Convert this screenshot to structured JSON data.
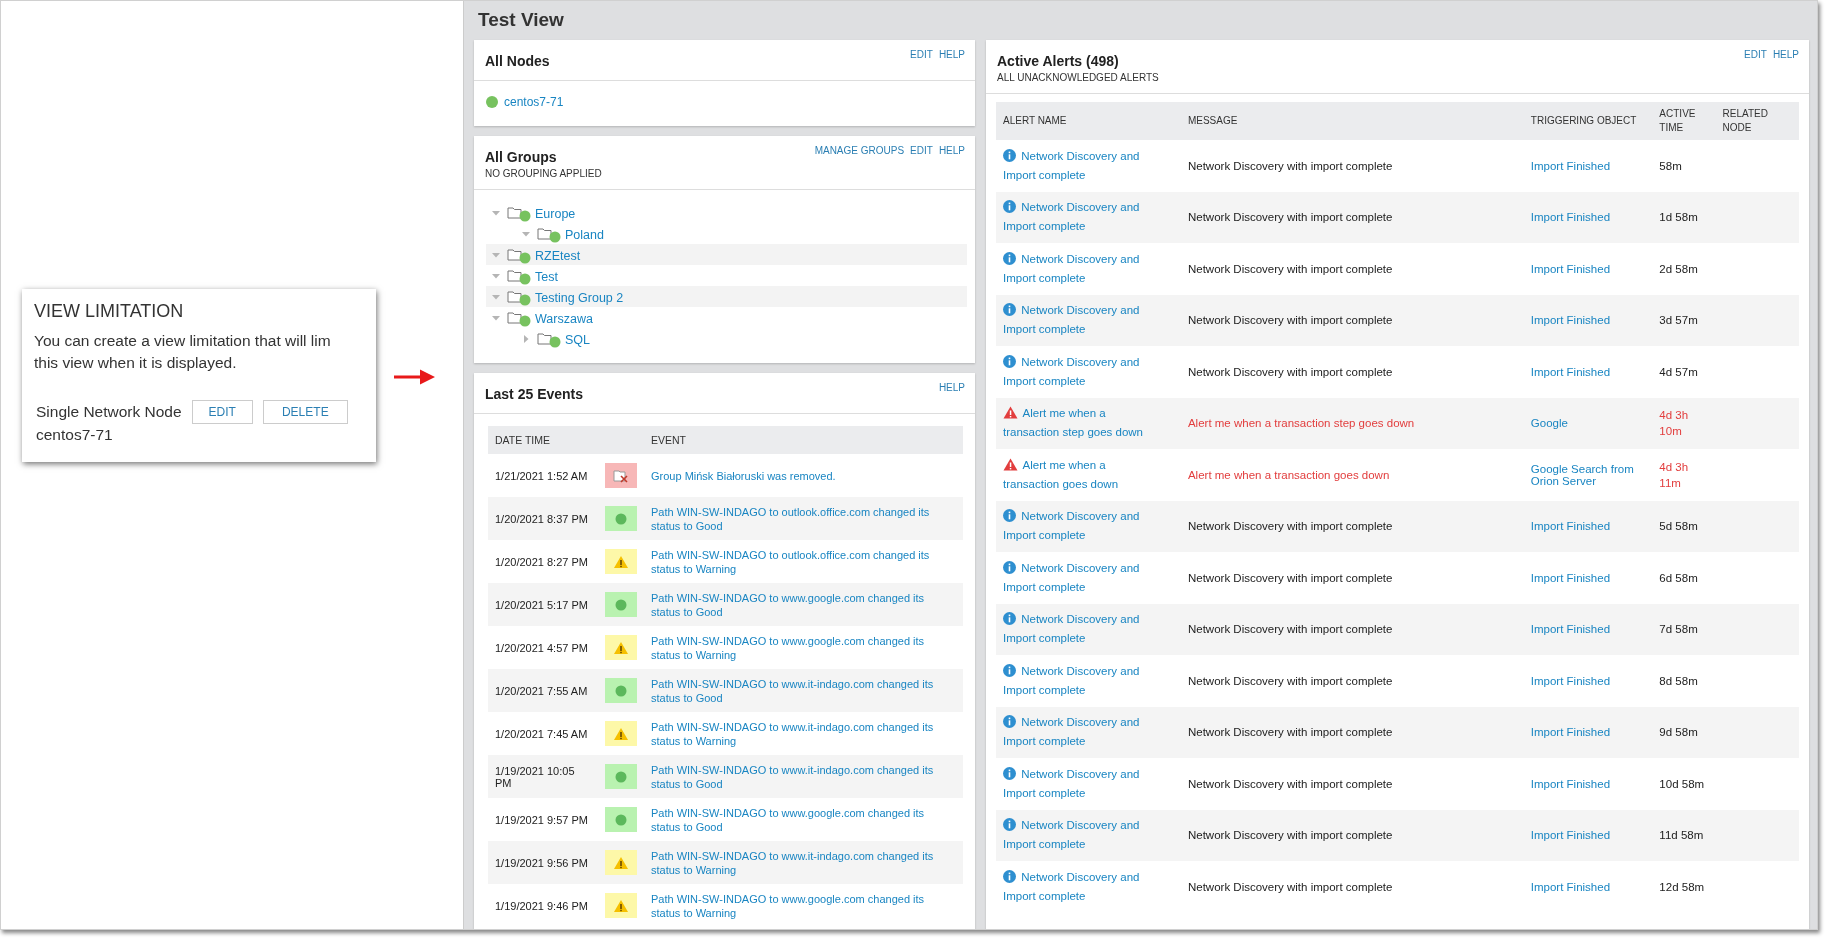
{
  "view_limitation": {
    "title": "VIEW LIMITATION",
    "text": "You can create a view limitation that will lim\nthis view when it is displayed.",
    "limit_name": "Single Network Node",
    "limit_value": "centos7-71",
    "buttons": [
      "EDIT",
      "DELETE"
    ]
  },
  "page_title": "Test View",
  "all_nodes": {
    "title": "All Nodes",
    "actions": [
      "EDIT",
      "HELP"
    ],
    "nodes": [
      {
        "name": "centos7-71",
        "color": "#77c25f"
      }
    ]
  },
  "all_groups": {
    "title": "All Groups",
    "subtitle": "NO GROUPING APPLIED",
    "actions": [
      "MANAGE GROUPS",
      "EDIT",
      "HELP"
    ],
    "groups": [
      {
        "name": "Europe",
        "color": "#77c25f",
        "expanded": true,
        "children": [
          {
            "name": "Poland",
            "color": "#77c25f",
            "expanded": true
          }
        ]
      },
      {
        "name": "RZEtest",
        "color": "#77c25f",
        "expanded": true
      },
      {
        "name": "Test",
        "color": "#77c25f",
        "expanded": true
      },
      {
        "name": "Testing Group 2",
        "color": "#77c25f",
        "expanded": true
      },
      {
        "name": "Warszawa",
        "color": "#77c25f",
        "expanded": true,
        "children": [
          {
            "name": "SQL",
            "color": "#77c25f",
            "expanded": false
          }
        ]
      }
    ]
  },
  "events": {
    "title": "Last 25 Events",
    "actions": [
      "HELP"
    ],
    "columns": [
      "DATE TIME",
      "EVENT"
    ],
    "rows": [
      {
        "time": "1/21/2021 1:52 AM",
        "kind": "removed",
        "text": "Group Mińsk Białoruski was removed."
      },
      {
        "time": "1/20/2021 8:37 PM",
        "kind": "good",
        "text": "Path WIN-SW-INDAGO to outlook.office.com changed its status to Good"
      },
      {
        "time": "1/20/2021 8:27 PM",
        "kind": "warning",
        "text": "Path WIN-SW-INDAGO to outlook.office.com changed its status to Warning"
      },
      {
        "time": "1/20/2021 5:17 PM",
        "kind": "good",
        "text": "Path WIN-SW-INDAGO to www.google.com changed its status to Good"
      },
      {
        "time": "1/20/2021 4:57 PM",
        "kind": "warning",
        "text": "Path WIN-SW-INDAGO to www.google.com changed its status to Warning"
      },
      {
        "time": "1/20/2021 7:55 AM",
        "kind": "good",
        "text": "Path WIN-SW-INDAGO to www.it-indago.com changed its status to Good"
      },
      {
        "time": "1/20/2021 7:45 AM",
        "kind": "warning",
        "text": "Path WIN-SW-INDAGO to www.it-indago.com changed its status to Warning"
      },
      {
        "time": "1/19/2021 10:05 PM",
        "kind": "good",
        "text": "Path WIN-SW-INDAGO to www.it-indago.com changed its status to Good"
      },
      {
        "time": "1/19/2021 9:57 PM",
        "kind": "good",
        "text": "Path WIN-SW-INDAGO to www.google.com changed its status to Good"
      },
      {
        "time": "1/19/2021 9:56 PM",
        "kind": "warning",
        "text": "Path WIN-SW-INDAGO to www.it-indago.com changed its status to Warning"
      },
      {
        "time": "1/19/2021 9:46 PM",
        "kind": "warning",
        "text": "Path WIN-SW-INDAGO to www.google.com changed its status to Warning"
      }
    ]
  },
  "alerts": {
    "title": "Active Alerts (498)",
    "subtitle": "ALL UNACKNOWLEDGED ALERTS",
    "actions": [
      "EDIT",
      "HELP"
    ],
    "columns": [
      "ALERT NAME",
      "MESSAGE",
      "TRIGGERING OBJECT",
      "ACTIVE TIME",
      "RELATED NODE"
    ],
    "rows": [
      {
        "kind": "info",
        "name": "Network Discovery and Import complete",
        "message": "Network Discovery with import complete",
        "object": "Import Finished",
        "active_time": "58m"
      },
      {
        "kind": "info",
        "name": "Network Discovery and Import complete",
        "message": "Network Discovery with import complete",
        "object": "Import Finished",
        "active_time": "1d 58m"
      },
      {
        "kind": "info",
        "name": "Network Discovery and Import complete",
        "message": "Network Discovery with import complete",
        "object": "Import Finished",
        "active_time": "2d 58m"
      },
      {
        "kind": "info",
        "name": "Network Discovery and Import complete",
        "message": "Network Discovery with import complete",
        "object": "Import Finished",
        "active_time": "3d 57m"
      },
      {
        "kind": "info",
        "name": "Network Discovery and Import complete",
        "message": "Network Discovery with import complete",
        "object": "Import Finished",
        "active_time": "4d 57m"
      },
      {
        "kind": "critical",
        "name": "Alert me when a transaction step goes down",
        "message": "Alert me when a transaction step goes down",
        "object": "Google",
        "active_time": "4d 3h 10m"
      },
      {
        "kind": "critical",
        "name": "Alert me when a transaction goes down",
        "message": "Alert me when a transaction goes down",
        "object": "Google Search from Orion Server",
        "active_time": "4d 3h 11m"
      },
      {
        "kind": "info",
        "name": "Network Discovery and Import complete",
        "message": "Network Discovery with import complete",
        "object": "Import Finished",
        "active_time": "5d 58m"
      },
      {
        "kind": "info",
        "name": "Network Discovery and Import complete",
        "message": "Network Discovery with import complete",
        "object": "Import Finished",
        "active_time": "6d 58m"
      },
      {
        "kind": "info",
        "name": "Network Discovery and Import complete",
        "message": "Network Discovery with import complete",
        "object": "Import Finished",
        "active_time": "7d 58m"
      },
      {
        "kind": "info",
        "name": "Network Discovery and Import complete",
        "message": "Network Discovery with import complete",
        "object": "Import Finished",
        "active_time": "8d 58m"
      },
      {
        "kind": "info",
        "name": "Network Discovery and Import complete",
        "message": "Network Discovery with import complete",
        "object": "Import Finished",
        "active_time": "9d 58m"
      },
      {
        "kind": "info",
        "name": "Network Discovery and Import complete",
        "message": "Network Discovery with import complete",
        "object": "Import Finished",
        "active_time": "10d 58m"
      },
      {
        "kind": "info",
        "name": "Network Discovery and Import complete",
        "message": "Network Discovery with import complete",
        "object": "Import Finished",
        "active_time": "11d 58m"
      },
      {
        "kind": "info",
        "name": "Network Discovery and Import complete",
        "message": "Network Discovery with import complete",
        "object": "Import Finished",
        "active_time": "12d 58m"
      }
    ]
  }
}
